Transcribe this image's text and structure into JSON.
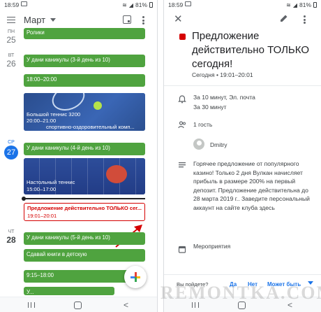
{
  "status": {
    "time": "18:59",
    "battery": "81%"
  },
  "left": {
    "month": "Март",
    "days": [
      {
        "dow": "ПН",
        "num": "25"
      },
      {
        "dow": "ВТ",
        "num": "26"
      },
      {
        "dow": "СР",
        "num": "27"
      },
      {
        "dow": "ЧТ",
        "num": "28"
      }
    ],
    "events": {
      "rollers": "Ролики",
      "vac3": "У дани каникулы (3-й день из 10)",
      "t1800": "18:00–20:00",
      "tennis_title": "Большой теннис 3200",
      "tennis_time": "20:00–21:00",
      "tennis_place": "спортивно-оздоровительный комп...",
      "vac4": "У дани каникулы (4-й день из 10)",
      "pingpong_title": "Настольный теннис",
      "pingpong_time": "15:00–17:00",
      "offer_title": "Предложение действительно ТОЛЬКО сег...",
      "offer_time": "19:01–20:01",
      "vac5": "У дани каникулы (5-й день из 10)",
      "books": "Сдавай книги в детскую",
      "t915": "9:15–18:00",
      "last": "У..."
    }
  },
  "right": {
    "title": "Предложение действительно ТОЛЬКО сегодня!",
    "date": "Сегодня  •  19:01–20:01",
    "reminder1": "За 10 минут, Эл. почта",
    "reminder2": "За 30 минут",
    "guests": "1 гость",
    "guest_name": "Dmitry",
    "description": "Горячее предложение от популярного казино! Только 2 дня Вулкан начисляет прибыль в размере 200% на первый депозит. Предложение действительна до 28 марта 2019 г.. Заведите персональный аккаунт на сайте клуба здесь",
    "calendar": "Мероприятия",
    "rsvp_question": "Вы пойдете?",
    "rsvp_yes": "Да",
    "rsvp_no": "Нет",
    "rsvp_maybe": "Может быть"
  },
  "watermark": "REMONTKA.COM",
  "colors": {
    "event_green": "#4fa33f",
    "accent_blue": "#1a73e8",
    "alert_red": "#d50000"
  }
}
